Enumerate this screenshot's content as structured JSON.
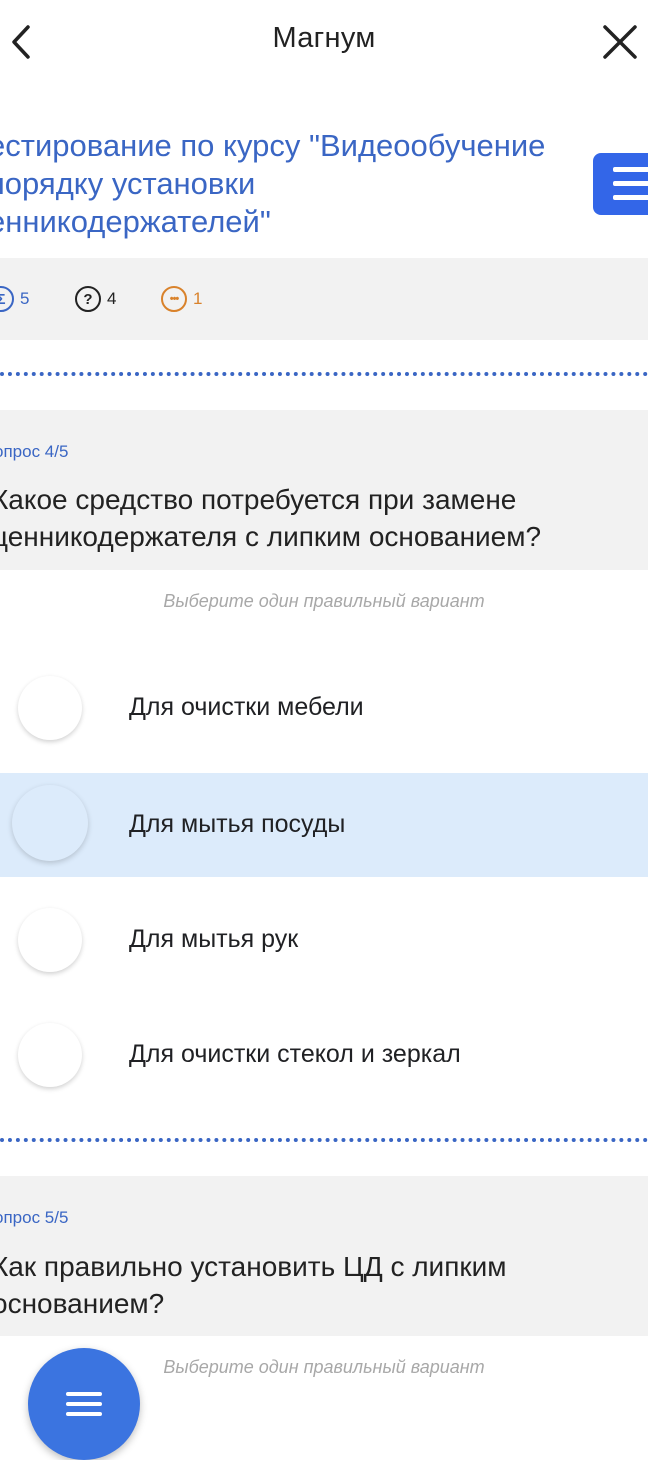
{
  "header": {
    "title": "Магнум",
    "back_icon": "chevron-left-icon",
    "close_icon": "close-icon"
  },
  "test": {
    "title": "естирование по курсу \"Видеообучение\n порядку установки\nенникодержателей\""
  },
  "stats": {
    "total": "5",
    "answered": "4",
    "pending": "1"
  },
  "questions": [
    {
      "label": "опрос 4/5",
      "text": "Какое средство потребуется при замене\nценникодержателя с липким основанием?",
      "hint": "Выберите один правильный вариант",
      "options": [
        {
          "label": "Для очистки мебели"
        },
        {
          "label": "Для мытья посуды"
        },
        {
          "label": "Для мытья рук"
        },
        {
          "label": "Для очистки стекол и зеркал"
        }
      ],
      "selected_index": 1
    },
    {
      "label": "опрос 5/5",
      "text": "Как правильно установить ЦД с липким\nоснованием?",
      "hint": "Выберите один правильный вариант"
    }
  ],
  "colors": {
    "accent": "#3a66c4",
    "menu_button": "#3366e8",
    "fab": "#3b74e0",
    "selected_bg": "#dcebfb",
    "pending": "#d9822b"
  }
}
